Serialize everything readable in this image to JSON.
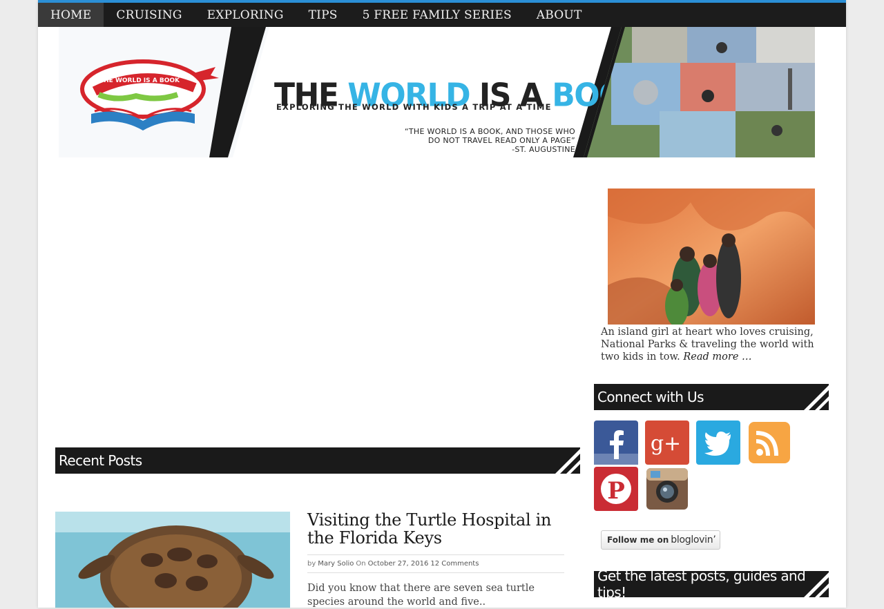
{
  "nav": {
    "items": [
      {
        "label": "HOME",
        "active": true
      },
      {
        "label": "CRUISING"
      },
      {
        "label": "EXPLORING"
      },
      {
        "label": "TIPS"
      },
      {
        "label": "5 FREE FAMILY SERIES"
      },
      {
        "label": "ABOUT"
      }
    ]
  },
  "banner": {
    "logo_text": "THE WORLD IS A BOOK",
    "logo_url": "www.theworldisabook.com",
    "title_the": "THE ",
    "title_world": "WORLD",
    "title_isa": " IS A ",
    "title_book": "BOOK",
    "subtitle": "EXPLORING THE WORLD WITH KIDS A TRIP AT A TIME",
    "quote_line1": "“THE WORLD IS A BOOK, AND THOSE WHO",
    "quote_line2": "DO NOT TRAVEL READ ONLY A PAGE”",
    "quote_line3": "-ST. AUGUSTINE"
  },
  "sidebar": {
    "about_text": "An island girl at heart who loves cruising, National Parks & traveling the world with two kids in tow. ",
    "read_more": "Read more …",
    "connect_title": "Connect with Us",
    "social": [
      "facebook-icon",
      "google-plus-icon",
      "twitter-icon",
      "rss-icon",
      "pinterest-icon",
      "instagram-icon"
    ],
    "bloglovin_follow": "Follow me on",
    "bloglovin_brand": "bloglovin’",
    "newsletter_title": "Get the latest posts, guides and tips!"
  },
  "recent": {
    "title": "Recent Posts",
    "post": {
      "title": "Visiting the Turtle Hospital in the Florida Keys",
      "by": "by",
      "author": "Mary Solio",
      "on": "On",
      "date": "October 27, 2016",
      "comments": "12 Comments",
      "excerpt": "Did you know that there are seven sea turtle species around the world and five.."
    }
  },
  "colors": {
    "nav_bg": "#1c1c1c",
    "accent_blue": "#36b4e5",
    "widget_bg": "#1a1a1a"
  }
}
